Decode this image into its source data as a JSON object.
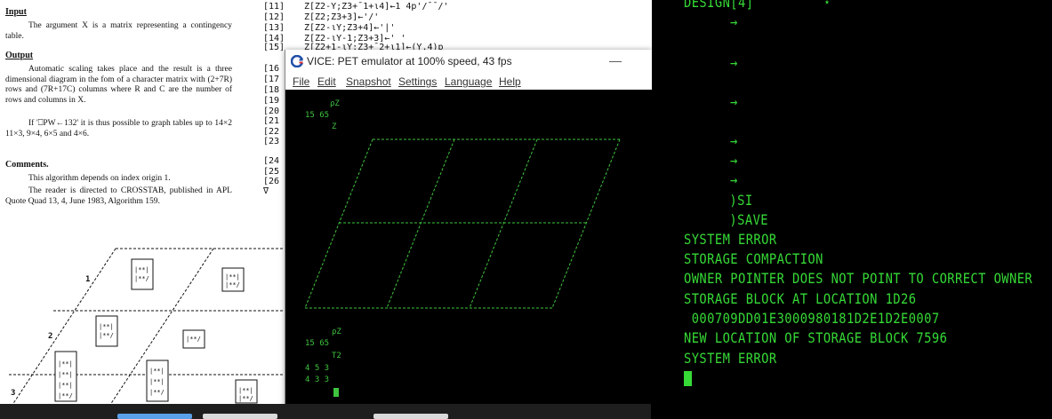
{
  "document": {
    "input_heading": "Input",
    "input_text": "The argument X is a matrix representing a contingency table.",
    "output_heading": "Output",
    "output_text": "Automatic scaling takes place and the result is a three dimensional diagram in the fom of a character matrix with (2+7R) rows and (7R+17C) columns where R and C are the number of rows and columns in X.",
    "output_text2": "If '⎕PW←132' it is thus possible to graph tables up to 14×2 11×3, 9×4, 6×5 and 4×6.",
    "comments_heading": "Comments.",
    "comments_text1": "This algorithm depends on index origin 1.",
    "comments_text2": "The reader is directed to CROSSTAB, published in APL Quote Quad 13, 4, June 1983, Algorithm 159.",
    "row_labels": [
      "1",
      "2",
      "3"
    ],
    "code_lines": [
      {
        "n": "[11]",
        "c": "Z[Z2-Y;Z3+¯1+ι4]←1 4p'/¯¯/'"
      },
      {
        "n": "[12]",
        "c": "Z[Z2;Z3+3]←'/'"
      },
      {
        "n": "[13]",
        "c": "Z[Z2-ιY;Z3+4]←'|'"
      },
      {
        "n": "[14]",
        "c": "Z[Z2-ιY-1;Z3+3]←' '"
      },
      {
        "n": "[15]",
        "c": "Z[Z2+1-ιY;Z3+¯2+ι1]←(Y,4)p"
      },
      {
        "n": "[16",
        "c": ""
      },
      {
        "n": "[17",
        "c": ""
      },
      {
        "n": "[18",
        "c": ""
      },
      {
        "n": "[19",
        "c": ""
      },
      {
        "n": "[20",
        "c": ""
      },
      {
        "n": "[21",
        "c": ""
      },
      {
        "n": "[22",
        "c": ""
      },
      {
        "n": "[23",
        "c": ""
      },
      {
        "n": "",
        "c": ""
      },
      {
        "n": "[24",
        "c": ""
      },
      {
        "n": "[25",
        "c": ""
      },
      {
        "n": "[26",
        "c": ""
      },
      {
        "n": "∇",
        "c": ""
      }
    ]
  },
  "vice": {
    "title": "VICE: PET emulator at 100% speed, 43 fps",
    "minimize": "—",
    "menu": [
      "File",
      "Edit",
      "Snapshot",
      "Settings",
      "Language",
      "Help"
    ],
    "screen": {
      "prompt1": "ρZ",
      "dims1": "15 65",
      "var1": "Z",
      "prompt2": "ρZ",
      "dims2": "15 65",
      "var2": "T2",
      "row1": "4 5 3",
      "row2": "4 3 3"
    }
  },
  "terminal": {
    "top_line": "DESIGN[4]         ⋆",
    "arrows": [
      "→",
      "→",
      "→",
      "→",
      "→",
      "→"
    ],
    "lines": [
      "  )SI",
      "  )SAVE",
      "SYSTEM ERROR",
      "STORAGE COMPACTION",
      "OWNER POINTER DOES NOT POINT TO CORRECT OWNER",
      "STORAGE BLOCK AT LOCATION 1D26",
      " 000709DD01E3000980181D2E1D2E0007",
      "NEW LOCATION OF STORAGE BLOCK 7596",
      "SYSTEM ERROR"
    ],
    "colors": {
      "text": "#36d936",
      "background": "#000000"
    }
  },
  "colors": {
    "pet_green": "#3ec43e",
    "vice_bg": "#000000"
  }
}
